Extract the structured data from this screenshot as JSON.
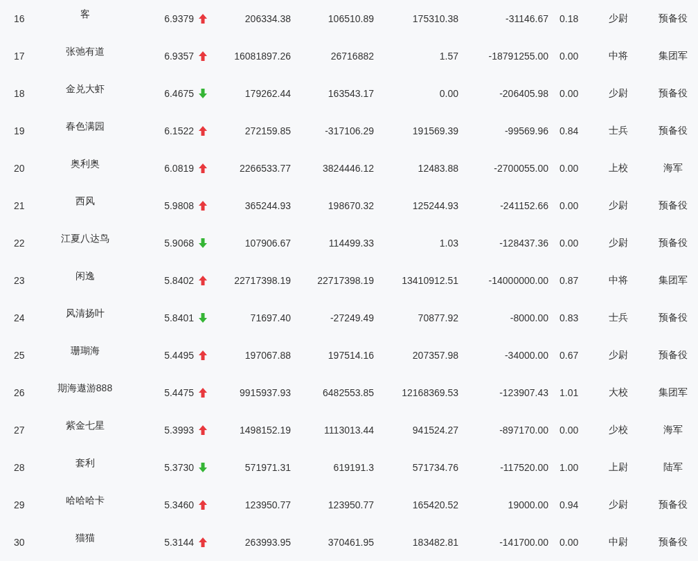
{
  "rows": [
    {
      "column_1": "16",
      "column_2": "客",
      "column_3": "6.9379",
      "rising": true,
      "column_4": "206334.38",
      "column_5": "106510.89",
      "column_6": "175310.38",
      "column_7": "-31146.67",
      "column_8": "0.18",
      "column_9": "少尉",
      "column_10": "预备役"
    },
    {
      "column_1": "17",
      "column_2": "张弛有道",
      "column_3": "6.9357",
      "rising": true,
      "column_4": "16081897.26",
      "column_5": "26716882",
      "column_6": "1.57",
      "column_7": "-18791255.00",
      "column_8": "0.00",
      "column_9": "中将",
      "column_10": "集团军"
    },
    {
      "column_1": "18",
      "column_2": "金兑大虾",
      "column_3": "6.4675",
      "rising": false,
      "column_4": "179262.44",
      "column_5": "163543.17",
      "column_6": "0.00",
      "column_7": "-206405.98",
      "column_8": "0.00",
      "column_9": "少尉",
      "column_10": "预备役"
    },
    {
      "column_1": "19",
      "column_2": "春色满园",
      "column_3": "6.1522",
      "rising": true,
      "column_4": "272159.85",
      "column_5": "-317106.29",
      "column_6": "191569.39",
      "column_7": "-99569.96",
      "column_8": "0.84",
      "column_9": "士兵",
      "column_10": "预备役"
    },
    {
      "column_1": "20",
      "column_2": "奥利奥",
      "column_3": "6.0819",
      "rising": true,
      "column_4": "2266533.77",
      "column_5": "3824446.12",
      "column_6": "12483.88",
      "column_7": "-2700055.00",
      "column_8": "0.00",
      "column_9": "上校",
      "column_10": "海军"
    },
    {
      "column_1": "21",
      "column_2": "西风",
      "column_3": "5.9808",
      "rising": true,
      "column_4": "365244.93",
      "column_5": "198670.32",
      "column_6": "125244.93",
      "column_7": "-241152.66",
      "column_8": "0.00",
      "column_9": "少尉",
      "column_10": "预备役"
    },
    {
      "column_1": "22",
      "column_2": "江夏八达鸟",
      "column_3": "5.9068",
      "rising": false,
      "column_4": "107906.67",
      "column_5": "114499.33",
      "column_6": "1.03",
      "column_7": "-128437.36",
      "column_8": "0.00",
      "column_9": "少尉",
      "column_10": "预备役"
    },
    {
      "column_1": "23",
      "column_2": "闲逸",
      "column_3": "5.8402",
      "rising": true,
      "column_4": "22717398.19",
      "column_5": "22717398.19",
      "column_6": "13410912.51",
      "column_7": "-14000000.00",
      "column_8": "0.87",
      "column_9": "中将",
      "column_10": "集团军"
    },
    {
      "column_1": "24",
      "column_2": "风清扬叶",
      "column_3": "5.8401",
      "rising": false,
      "column_4": "71697.40",
      "column_5": "-27249.49",
      "column_6": "70877.92",
      "column_7": "-8000.00",
      "column_8": "0.83",
      "column_9": "士兵",
      "column_10": "预备役"
    },
    {
      "column_1": "25",
      "column_2": "珊瑚海",
      "column_3": "5.4495",
      "rising": true,
      "column_4": "197067.88",
      "column_5": "197514.16",
      "column_6": "207357.98",
      "column_7": "-34000.00",
      "column_8": "0.67",
      "column_9": "少尉",
      "column_10": "预备役"
    },
    {
      "column_1": "26",
      "column_2": "期海遨游888",
      "column_3": "5.4475",
      "rising": true,
      "column_4": "9915937.93",
      "column_5": "6482553.85",
      "column_6": "12168369.53",
      "column_7": "-123907.43",
      "column_8": "1.01",
      "column_9": "大校",
      "column_10": "集团军"
    },
    {
      "column_1": "27",
      "column_2": "紫金七星",
      "column_3": "5.3993",
      "rising": true,
      "column_4": "1498152.19",
      "column_5": "1113013.44",
      "column_6": "941524.27",
      "column_7": "-897170.00",
      "column_8": "0.00",
      "column_9": "少校",
      "column_10": "海军"
    },
    {
      "column_1": "28",
      "column_2": "套利",
      "column_3": "5.3730",
      "rising": false,
      "column_4": "571971.31",
      "column_5": "619191.3",
      "column_6": "571734.76",
      "column_7": "-117520.00",
      "column_8": "1.00",
      "column_9": "上尉",
      "column_10": "陆军"
    },
    {
      "column_1": "29",
      "column_2": "哈哈哈卡",
      "column_3": "5.3460",
      "rising": true,
      "column_4": "123950.77",
      "column_5": "123950.77",
      "column_6": "165420.52",
      "column_7": "19000.00",
      "column_8": "0.94",
      "column_9": "少尉",
      "column_10": "预备役"
    },
    {
      "column_1": "30",
      "column_2": "猫猫",
      "column_3": "5.3144",
      "rising": true,
      "column_4": "263993.95",
      "column_5": "370461.95",
      "column_6": "183482.81",
      "column_7": "-141700.00",
      "column_8": "0.00",
      "column_9": "中尉",
      "column_10": "预备役"
    }
  ]
}
